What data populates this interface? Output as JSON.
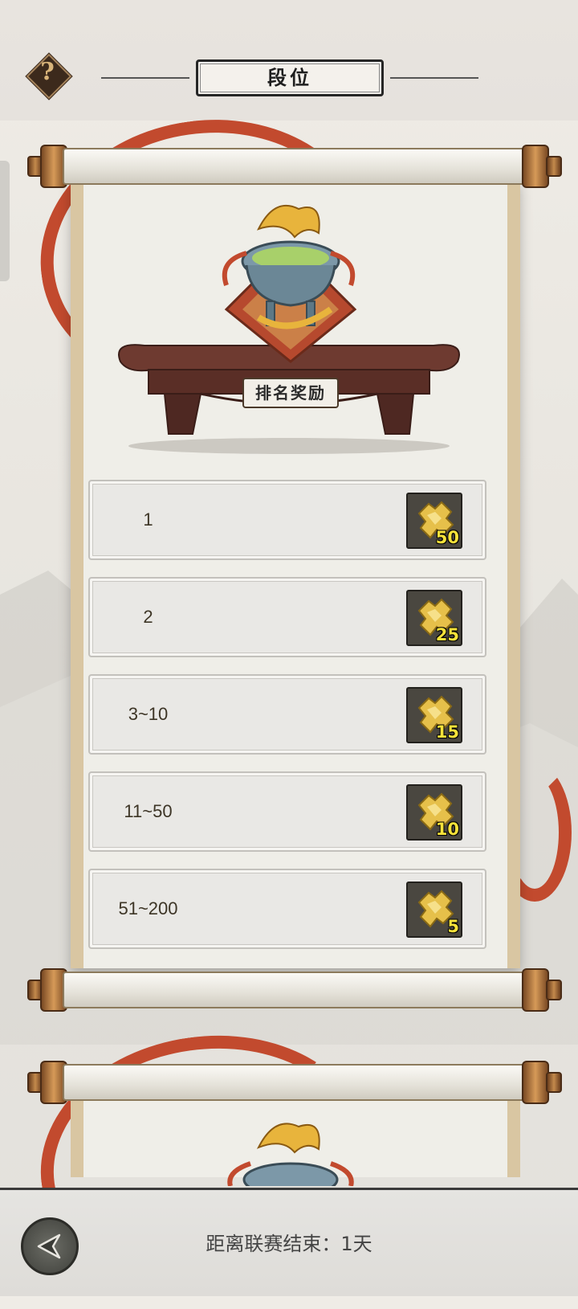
{
  "header": {
    "help_icon": "question-mark-icon",
    "title": "段位"
  },
  "scroll": {
    "section_label": "排名奖励",
    "rewards": [
      {
        "rank": "1",
        "item_icon": "gold-puzzle-fragment-icon",
        "count": "50"
      },
      {
        "rank": "2",
        "item_icon": "gold-puzzle-fragment-icon",
        "count": "25"
      },
      {
        "rank": "3~10",
        "item_icon": "gold-puzzle-fragment-icon",
        "count": "15"
      },
      {
        "rank": "11~50",
        "item_icon": "gold-puzzle-fragment-icon",
        "count": "10"
      },
      {
        "rank": "51~200",
        "item_icon": "gold-puzzle-fragment-icon",
        "count": "5"
      }
    ]
  },
  "footer": {
    "back_icon": "back-arrow-icon",
    "countdown": "距离联赛结束：1天"
  },
  "colors": {
    "ribbon": "#c24a2e",
    "count_text": "#f5e23a",
    "paper": "#efeee8"
  }
}
